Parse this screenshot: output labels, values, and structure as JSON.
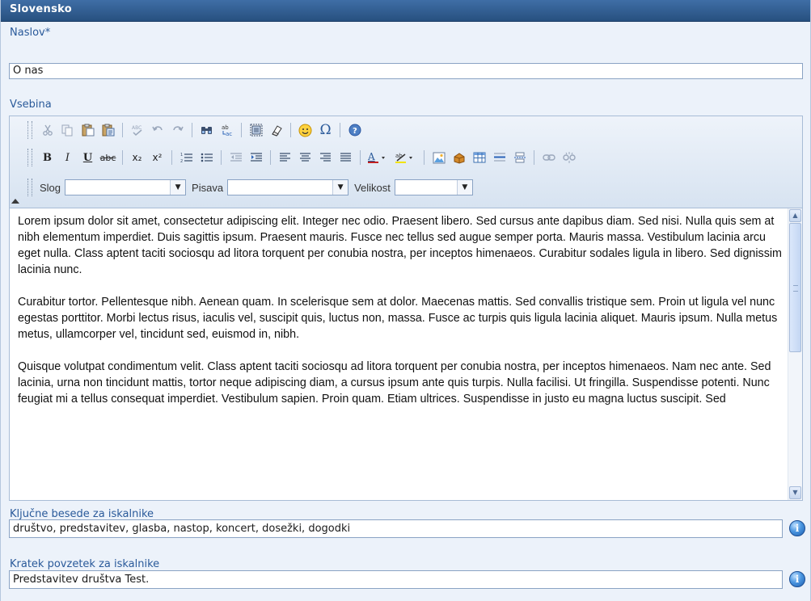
{
  "panel": {
    "title": "Slovensko"
  },
  "title_field": {
    "label": "Naslov*",
    "value": "O nas"
  },
  "content_field": {
    "label": "Vsebina"
  },
  "editor": {
    "format_controls": [
      {
        "label": "Slog",
        "value": ""
      },
      {
        "label": "Pisava",
        "value": ""
      },
      {
        "label": "Velikost",
        "value": ""
      }
    ],
    "toolbar_text": {
      "bold": "B",
      "italic": "I",
      "underline": "U",
      "strike": "abc",
      "subscript": "x₂",
      "superscript": "x²",
      "special_char": "Ω"
    },
    "paragraphs": [
      "Lorem ipsum dolor sit amet, consectetur adipiscing elit. Integer nec odio. Praesent libero. Sed cursus ante dapibus diam. Sed nisi. Nulla quis sem at nibh elementum imperdiet. Duis sagittis ipsum. Praesent mauris. Fusce nec tellus sed augue semper porta. Mauris massa. Vestibulum lacinia arcu eget nulla. Class aptent taciti sociosqu ad litora torquent per conubia nostra, per inceptos himenaeos. Curabitur sodales ligula in libero. Sed dignissim lacinia nunc.",
      "Curabitur tortor. Pellentesque nibh. Aenean quam. In scelerisque sem at dolor. Maecenas mattis. Sed convallis tristique sem. Proin ut ligula vel nunc egestas porttitor. Morbi lectus risus, iaculis vel, suscipit quis, luctus non, massa. Fusce ac turpis quis ligula lacinia aliquet. Mauris ipsum. Nulla metus metus, ullamcorper vel, tincidunt sed, euismod in, nibh.",
      "Quisque volutpat condimentum velit. Class aptent taciti sociosqu ad litora torquent per conubia nostra, per inceptos himenaeos. Nam nec ante. Sed lacinia, urna non tincidunt mattis, tortor neque adipiscing diam, a cursus ipsum ante quis turpis. Nulla facilisi. Ut fringilla. Suspendisse potenti. Nunc feugiat mi a tellus consequat imperdiet. Vestibulum sapien. Proin quam. Etiam ultrices. Suspendisse in justo eu magna luctus suscipit. Sed"
    ]
  },
  "keywords_field": {
    "label": "Ključne besede za iskalnike",
    "value": "društvo, predstavitev, glasba, nastop, koncert, dosežki, dogodki",
    "info_glyph": "i"
  },
  "summary_field": {
    "label": "Kratek povzetek za iskalnike",
    "value": "Predstavitev društva Test.",
    "info_glyph": "i"
  },
  "colors": {
    "header_bg": "#2f5d93",
    "panel_bg": "#ecf2fa",
    "label_color": "#2a5a9a",
    "toolbar_bg": "#dde7f4"
  }
}
